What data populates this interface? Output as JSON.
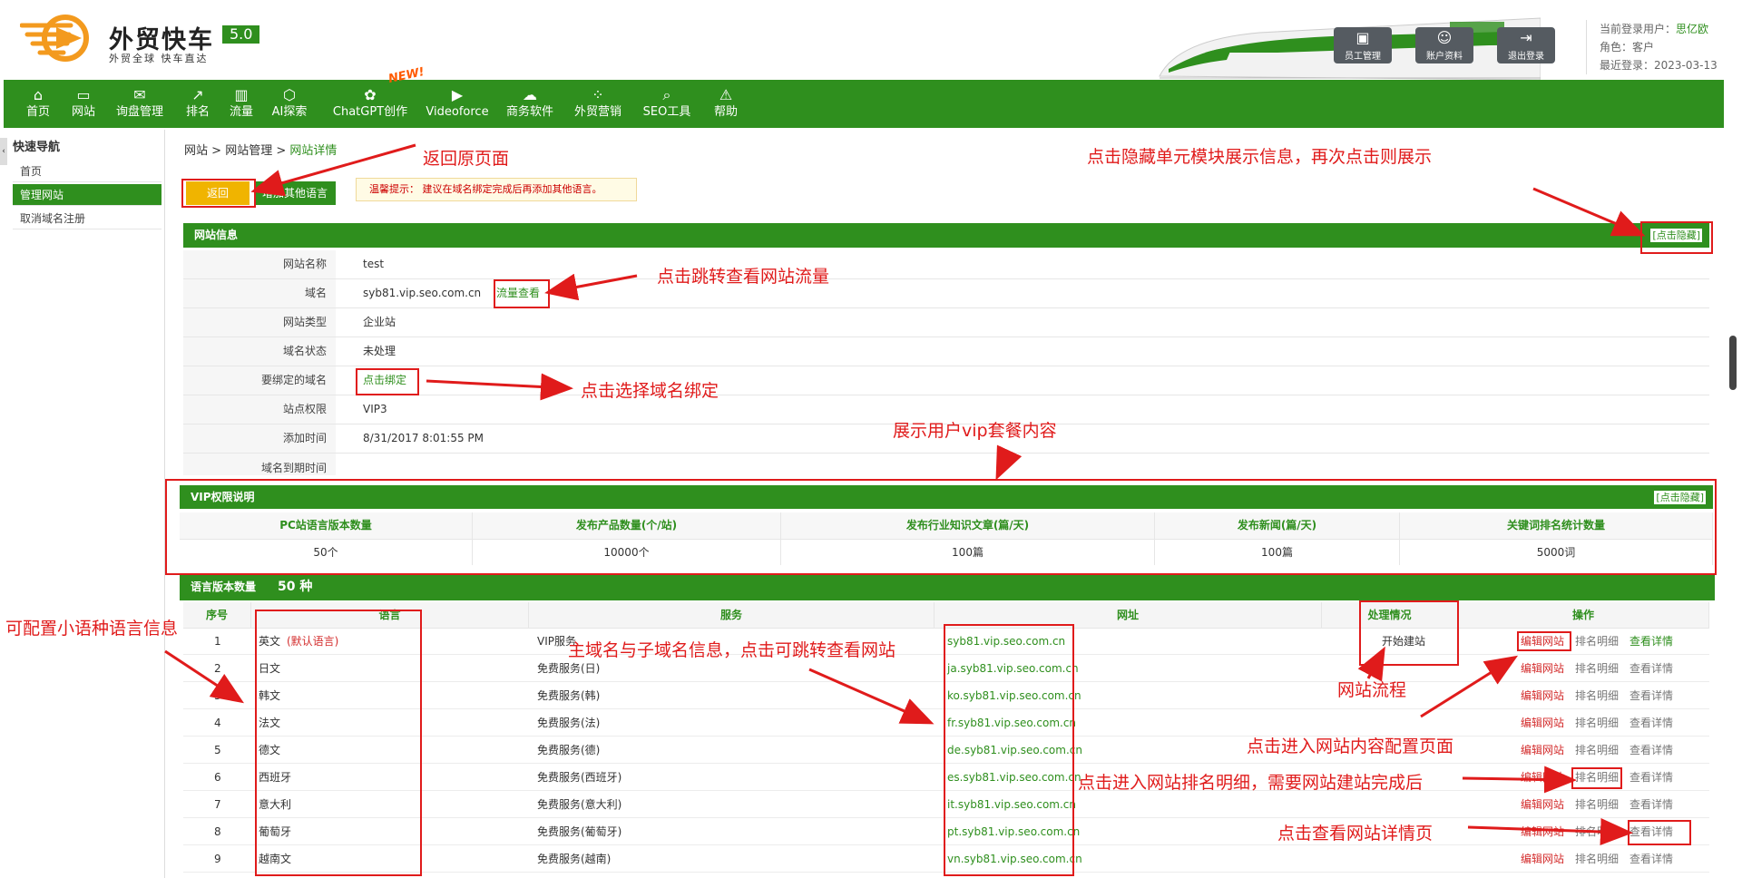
{
  "header": {
    "brand": "外贸快车",
    "version": "5.0",
    "slogan": "外贸全球 快车直达",
    "buttons": [
      {
        "label": "员工管理",
        "icon": "staff-icon"
      },
      {
        "label": "账户资料",
        "icon": "account-icon"
      },
      {
        "label": "退出登录",
        "icon": "logout-icon"
      }
    ],
    "user": {
      "login_label": "当前登录用户：",
      "login_value": "思亿欧",
      "role_label": "角色：",
      "role_value": "客户",
      "last_label": "最近登录：",
      "last_value": "2023-03-13"
    }
  },
  "nav": {
    "items": [
      "首页",
      "网站",
      "询盘管理",
      "排名",
      "流量",
      "AI探索",
      "ChatGPT创作",
      "Videoforce",
      "商务软件",
      "外贸营销",
      "SEO工具",
      "帮助"
    ],
    "new_badge": "NEW!"
  },
  "sidebar": {
    "title": "快速导航",
    "items": [
      "首页",
      "管理网站",
      "取消域名注册"
    ]
  },
  "breadcrumb": {
    "part1": "网站",
    "sep": " > ",
    "part2": "网站管理",
    "part3": "网站详情"
  },
  "toolbar": {
    "back": "返回",
    "add_lang": "增加其他语言",
    "tip": "温馨提示：  建议在域名绑定完成后再添加其他语言。"
  },
  "site_info": {
    "title": "网站信息",
    "hide": "[点击隐藏]",
    "rows": [
      {
        "label": "网站名称",
        "value": "test"
      },
      {
        "label": "域名",
        "value": "syb81.vip.seo.com.cn",
        "link": "流量查看"
      },
      {
        "label": "网站类型",
        "value": "企业站"
      },
      {
        "label": "域名状态",
        "value": "未处理"
      },
      {
        "label": "要绑定的域名",
        "link": "点击绑定"
      },
      {
        "label": "站点权限",
        "value": "VIP3"
      },
      {
        "label": "添加时间",
        "value": "8/31/2017 8:01:55 PM"
      },
      {
        "label": "域名到期时间",
        "value": ""
      }
    ]
  },
  "vip": {
    "title": "VIP权限说明",
    "hide": "[点击隐藏]",
    "headers": [
      "PC站语言版本数量",
      "发布产品数量(个/站)",
      "发布行业知识文章(篇/天)",
      "发布新闻(篇/天)",
      "关键词排名统计数量"
    ],
    "values": [
      "50个",
      "10000个",
      "100篇",
      "100篇",
      "5000词"
    ]
  },
  "languages": {
    "title": "语言版本数量",
    "count": "50 种",
    "headers": [
      "序号",
      "语言",
      "服务",
      "网址",
      "处理情况",
      "操作"
    ],
    "default_tag": "(默认语言)",
    "ops": [
      "编辑网站",
      "排名明细",
      "查看详情"
    ],
    "rows": [
      {
        "no": "1",
        "lang": "英文",
        "service": "VIP服务",
        "url": "syb81.vip.seo.com.cn",
        "status": "开始建站"
      },
      {
        "no": "2",
        "lang": "日文",
        "service": "免费服务(日)",
        "url": "ja.syb81.vip.seo.com.cn",
        "status": ""
      },
      {
        "no": "3",
        "lang": "韩文",
        "service": "免费服务(韩)",
        "url": "ko.syb81.vip.seo.com.cn",
        "status": ""
      },
      {
        "no": "4",
        "lang": "法文",
        "service": "免费服务(法)",
        "url": "fr.syb81.vip.seo.com.cn",
        "status": ""
      },
      {
        "no": "5",
        "lang": "德文",
        "service": "免费服务(德)",
        "url": "de.syb81.vip.seo.com.cn",
        "status": ""
      },
      {
        "no": "6",
        "lang": "西班牙",
        "service": "免费服务(西班牙)",
        "url": "es.syb81.vip.seo.com.cn",
        "status": ""
      },
      {
        "no": "7",
        "lang": "意大利",
        "service": "免费服务(意大利)",
        "url": "it.syb81.vip.seo.com.cn",
        "status": ""
      },
      {
        "no": "8",
        "lang": "葡萄牙",
        "service": "免费服务(葡萄牙)",
        "url": "pt.syb81.vip.seo.com.cn",
        "status": ""
      },
      {
        "no": "9",
        "lang": "越南文",
        "service": "免费服务(越南)",
        "url": "vn.syb81.vip.seo.com.cn",
        "status": ""
      }
    ]
  },
  "annotations": {
    "back": "返回原页面",
    "hide": "点击隐藏单元模块展示信息，再次点击则展示",
    "traffic": "点击跳转查看网站流量",
    "bind": "点击选择域名绑定",
    "vip": "展示用户vip套餐内容",
    "lang": "可配置小语种语言信息",
    "domain": "主域名与子域名信息，点击可跳转查看网站",
    "flow": "网站流程",
    "edit": "点击进入网站内容配置页面",
    "rank": "点击进入网站排名明细，需要网站建站完成后",
    "detail": "点击查看网站详情页"
  }
}
